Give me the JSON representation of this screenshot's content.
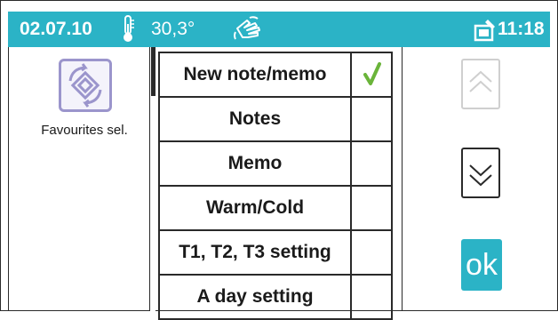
{
  "statusbar": {
    "date": "02.07.10",
    "temperature": "30,3°",
    "time": "11:18",
    "icons": [
      "thermometer-icon",
      "hand-wave-icon",
      "note-icon"
    ]
  },
  "favourites": {
    "label": "Favourites sel.",
    "icon": "favourites-icon"
  },
  "menu": {
    "items": [
      {
        "label": "New note/memo",
        "checked": true
      },
      {
        "label": "Notes",
        "checked": false
      },
      {
        "label": "Memo",
        "checked": false
      },
      {
        "label": "Warm/Cold",
        "checked": false
      },
      {
        "label": "T1, T2, T3 setting",
        "checked": false
      },
      {
        "label": "A day setting",
        "checked": false
      }
    ]
  },
  "controls": {
    "ok_label": "ok",
    "up_icon": "chevron-up-icon",
    "down_icon": "chevron-down-icon"
  },
  "colors": {
    "accent": "#2bb3c6",
    "check": "#6ab43a",
    "favourites": "#9b95cc"
  }
}
